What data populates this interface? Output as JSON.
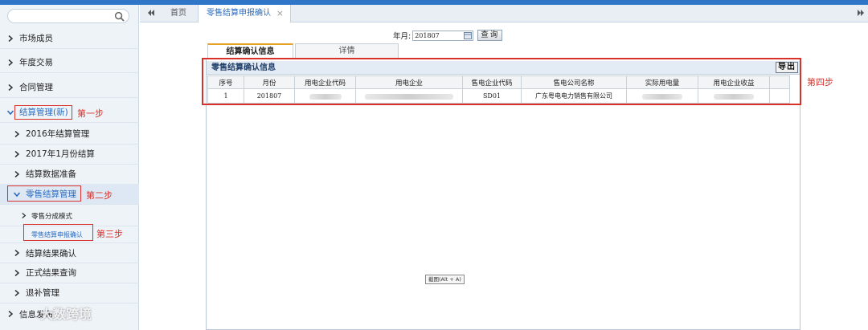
{
  "sidebar": {
    "search_placeholder": "",
    "items": [
      {
        "label": "市场成员"
      },
      {
        "label": "年度交易"
      },
      {
        "label": "合同管理"
      },
      {
        "label": "结算管理(新)"
      },
      {
        "label": "2016年结算管理"
      },
      {
        "label": "2017年1月份结算"
      },
      {
        "label": "结算数据准备"
      },
      {
        "label": "零售结算管理"
      },
      {
        "label": "零售分成模式"
      },
      {
        "label": "零售结算申报确认"
      },
      {
        "label": "结算结果确认"
      },
      {
        "label": "正式结果查询"
      },
      {
        "label": "退补管理"
      },
      {
        "label": "信息发布"
      }
    ]
  },
  "annotations": {
    "step1": "第一步",
    "step2": "第二步",
    "step3": "第三步",
    "step4": "第四步"
  },
  "tabs": {
    "home": "首页",
    "current": "零售结算申报确认",
    "close": "×"
  },
  "filter": {
    "month_label": "年月:",
    "month_value": "201807",
    "query_label": "查询"
  },
  "subtabs": {
    "settle_info": "结算确认信息",
    "detail": "详情"
  },
  "panel": {
    "title": "零售结算确认信息",
    "export_label": "导出"
  },
  "table": {
    "columns": [
      "序号",
      "月份",
      "用电企业代码",
      "用电企业",
      "售电企业代码",
      "售电公司名称",
      "实际用电量",
      "用电企业收益"
    ],
    "rows": [
      [
        "1",
        "201807",
        "",
        "",
        "SD01",
        "广东粤电电力销售有限公司",
        "",
        ""
      ]
    ]
  },
  "tooltip": "截图(Alt + A)",
  "watermark": "大数跨境",
  "colors": {
    "accent": "#2f76c8",
    "annotation_red": "#d9322a",
    "link_blue": "#2a6cc0"
  }
}
